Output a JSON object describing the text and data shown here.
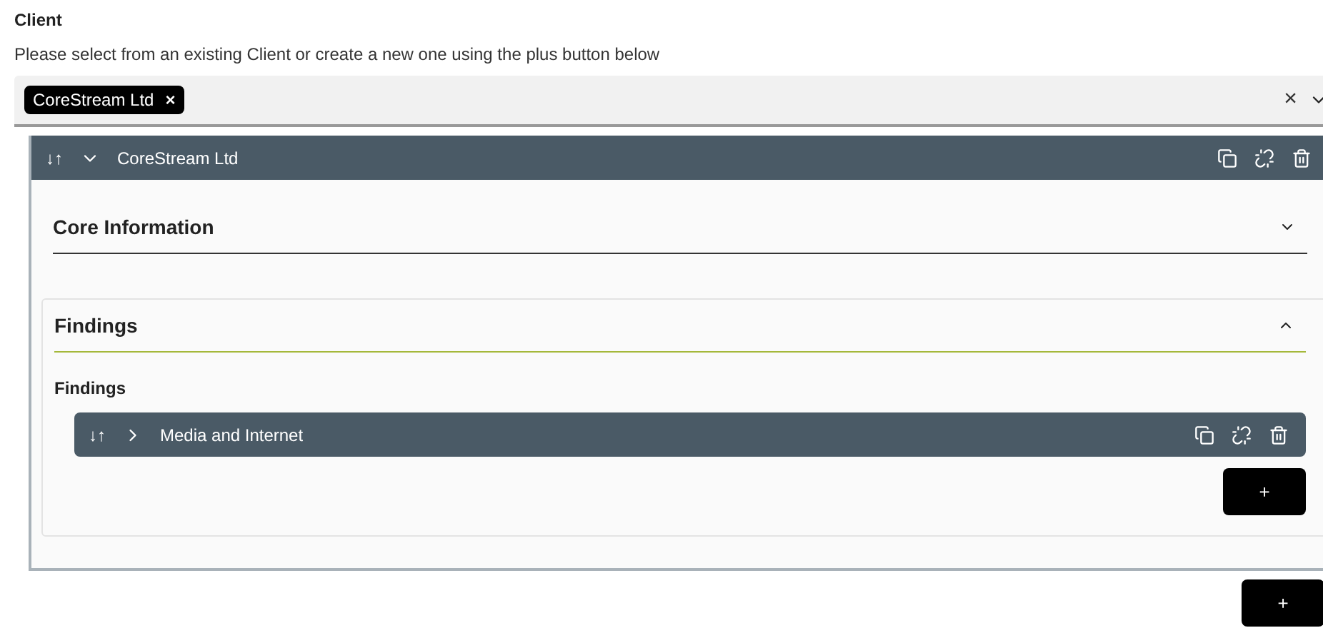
{
  "field": {
    "label": "Client",
    "hint": "Please select from an existing Client or create a new one using the plus button below",
    "chips": [
      {
        "label": "CoreStream Ltd",
        "remove": "×"
      }
    ],
    "clear": "×"
  },
  "item": {
    "title": "CoreStream Ltd",
    "sort": "↓↑",
    "expanded": true,
    "sections": [
      {
        "title": "Core Information",
        "expanded": false,
        "kind": "plain"
      },
      {
        "title": "Findings",
        "expanded": true,
        "kind": "card",
        "sublabel": "Findings",
        "items": [
          {
            "title": "Media and Internet",
            "sort": "↓↑",
            "expanded": false
          }
        ],
        "add": "+"
      }
    ]
  },
  "add": "+"
}
